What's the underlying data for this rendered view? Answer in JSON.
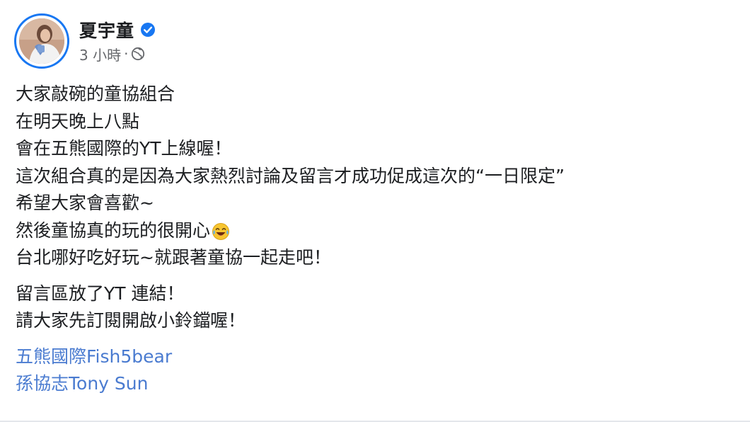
{
  "post": {
    "author": "夏宇童",
    "time": "3 小時",
    "separator": "·",
    "icons": {
      "verified": "verified-badge-icon",
      "audience": "globe-icon",
      "emoji": "laughing-crying-emoji-icon"
    },
    "colors": {
      "accent": "#1877f2",
      "link": "#4a7bd0",
      "text": "#1c1e21",
      "muted": "#65676b"
    },
    "lines": [
      "大家敲碗的童協組合",
      "在明天晚上八點",
      "會在五熊國際的YT上線喔！",
      "這次組合真的是因為大家熱烈討論及留言才成功促成這次的“一日限定”",
      "希望大家會喜歡~",
      "然後童協真的玩的很開心",
      "台北哪好吃好玩~就跟著童協一起走吧！"
    ],
    "lines2": [
      "留言區放了YT 連結！",
      "請大家先訂閱開啟小鈴鐺喔！"
    ],
    "tags": [
      "五熊國際Fish5bear",
      "孫協志Tony Sun"
    ]
  }
}
